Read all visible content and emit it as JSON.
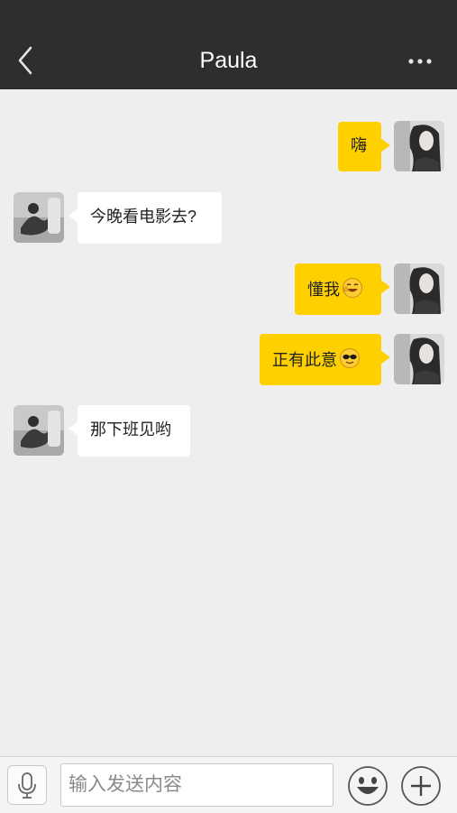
{
  "header": {
    "title": "Paula",
    "back_icon": "chevron-left-icon",
    "more_icon": "more-dots-icon"
  },
  "messages": [
    {
      "sender": "me",
      "text": "嗨"
    },
    {
      "sender": "other",
      "text": "今晚看电影去?"
    },
    {
      "sender": "me",
      "text": "懂我",
      "emoji": "grin-emoji"
    },
    {
      "sender": "me",
      "text": "正有此意",
      "emoji": "sunglasses-emoji"
    },
    {
      "sender": "other",
      "text": "那下班见哟"
    }
  ],
  "input": {
    "placeholder": "输入发送内容",
    "value": ""
  },
  "colors": {
    "topbar": "#2e2e2e",
    "my_bubble": "#ffd000",
    "other_bubble": "#ffffff",
    "background": "#eeeeee"
  }
}
